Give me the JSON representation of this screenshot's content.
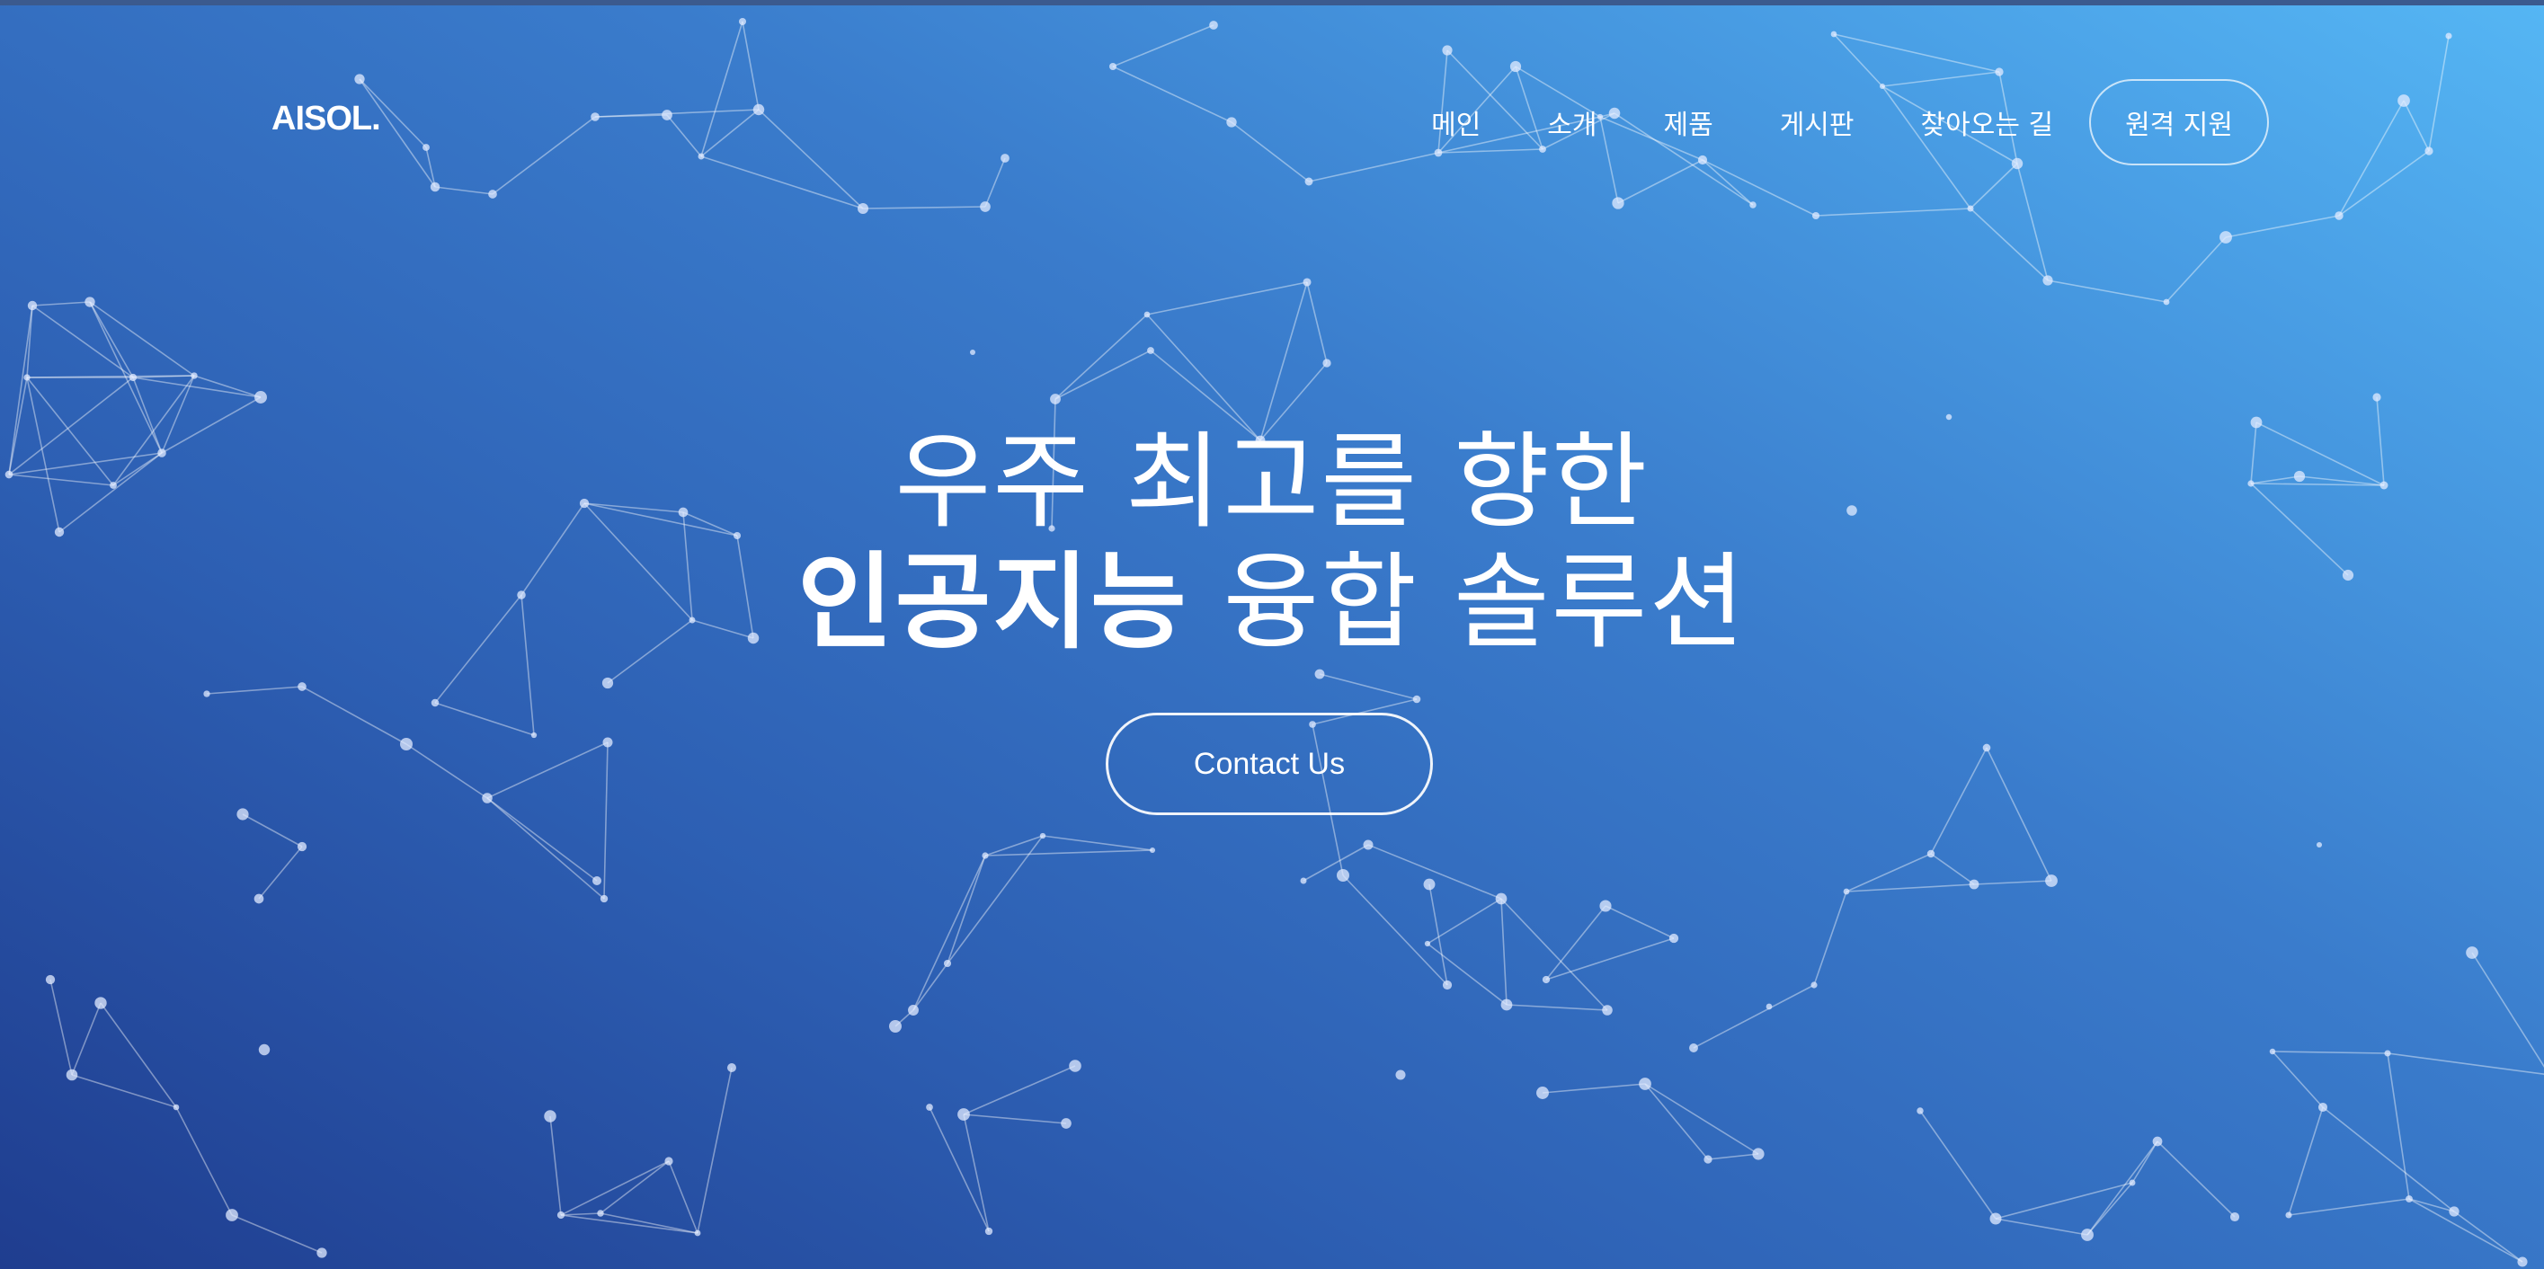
{
  "header": {
    "logo": "AISOL.",
    "nav": [
      "메인",
      "소개",
      "제품",
      "게시판",
      "찾아오는 길"
    ],
    "support_button": "원격 지원"
  },
  "hero": {
    "headline_line1": "우주 최고를 향한",
    "headline_line2_strong": "인공지능",
    "headline_line2_rest": " 융합 솔루션",
    "cta_label": "Contact Us"
  },
  "colors": {
    "gradient_dark": "#1f3d8f",
    "gradient_light": "#55b6f4",
    "text": "#ffffff"
  }
}
